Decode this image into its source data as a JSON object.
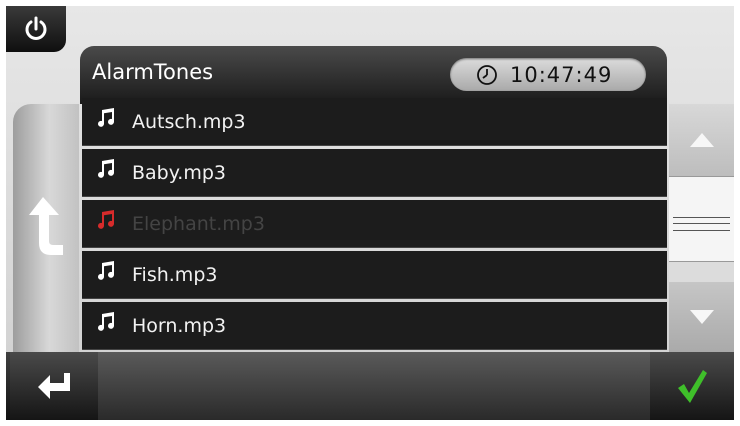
{
  "header": {
    "title": "AlarmTones",
    "time": "10:47:49"
  },
  "list": {
    "items": [
      {
        "label": "Autsch.mp3",
        "selected": false
      },
      {
        "label": "Baby.mp3",
        "selected": false
      },
      {
        "label": "Elephant.mp3",
        "selected": true
      },
      {
        "label": "Fish.mp3",
        "selected": false
      },
      {
        "label": "Horn.mp3",
        "selected": false
      }
    ]
  },
  "icons": {
    "power": "power-icon",
    "clock": "clock-icon",
    "note": "music-note-icon",
    "back": "back-arrow-icon",
    "enter": "return-arrow-icon",
    "ok": "checkmark-icon",
    "scroll_up": "arrow-up-icon",
    "scroll_down": "arrow-down-icon"
  },
  "colors": {
    "note_default": "#ffffff",
    "note_selected": "#d62b2b",
    "confirm": "#3fbf2a"
  }
}
